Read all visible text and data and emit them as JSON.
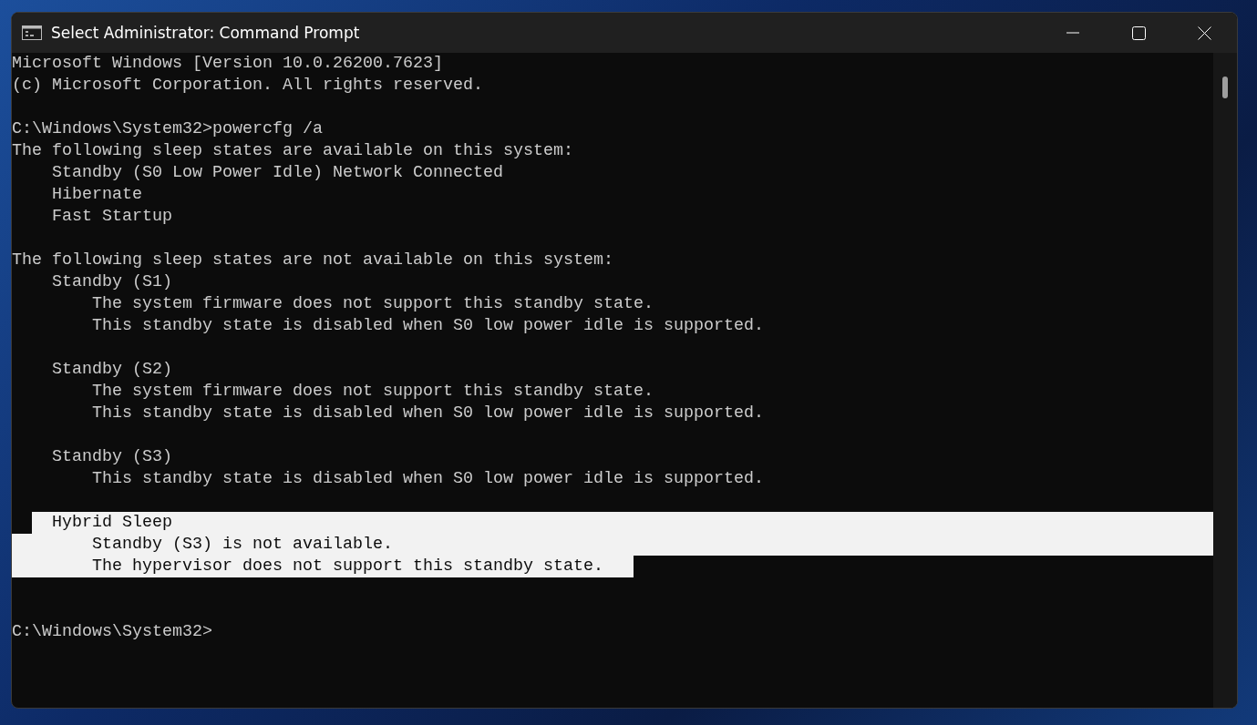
{
  "window": {
    "title": "Select Administrator: Command Prompt"
  },
  "console": {
    "lines": [
      {
        "kind": "text",
        "text": "Microsoft Windows [Version 10.0.26200.7623]",
        "selected": false
      },
      {
        "kind": "text",
        "text": "(c) Microsoft Corporation. All rights reserved.",
        "selected": false
      },
      {
        "kind": "blank",
        "selected": false
      },
      {
        "kind": "text",
        "text": "C:\\Windows\\System32>powercfg /a",
        "selected": false
      },
      {
        "kind": "text",
        "text": "The following sleep states are available on this system:",
        "selected": false
      },
      {
        "kind": "text",
        "text": "    Standby (S0 Low Power Idle) Network Connected",
        "selected": false
      },
      {
        "kind": "text",
        "text": "    Hibernate",
        "selected": false
      },
      {
        "kind": "text",
        "text": "    Fast Startup",
        "selected": false
      },
      {
        "kind": "blank",
        "selected": false
      },
      {
        "kind": "text",
        "text": "The following sleep states are not available on this system:",
        "selected": false
      },
      {
        "kind": "text",
        "text": "    Standby (S1)",
        "selected": false
      },
      {
        "kind": "text",
        "text": "        The system firmware does not support this standby state.",
        "selected": false
      },
      {
        "kind": "text",
        "text": "        This standby state is disabled when S0 low power idle is supported.",
        "selected": false
      },
      {
        "kind": "blank",
        "selected": false
      },
      {
        "kind": "text",
        "text": "    Standby (S2)",
        "selected": false
      },
      {
        "kind": "text",
        "text": "        The system firmware does not support this standby state.",
        "selected": false
      },
      {
        "kind": "text",
        "text": "        This standby state is disabled when S0 low power idle is supported.",
        "selected": false
      },
      {
        "kind": "blank",
        "selected": false
      },
      {
        "kind": "text",
        "text": "    Standby (S3)",
        "selected": false
      },
      {
        "kind": "text",
        "text": "        This standby state is disabled when S0 low power idle is supported.",
        "selected": false
      },
      {
        "kind": "blank",
        "selected": false
      },
      {
        "kind": "text",
        "text": "    Hybrid Sleep",
        "selected": true
      },
      {
        "kind": "text",
        "text": "        Standby (S3) is not available.",
        "selected": true
      },
      {
        "kind": "text",
        "text": "        The hypervisor does not support this standby state.",
        "selected": true
      },
      {
        "kind": "blank",
        "selected": false
      },
      {
        "kind": "blank",
        "selected": false
      },
      {
        "kind": "text",
        "text": "C:\\Windows\\System32>",
        "selected": false
      }
    ]
  }
}
